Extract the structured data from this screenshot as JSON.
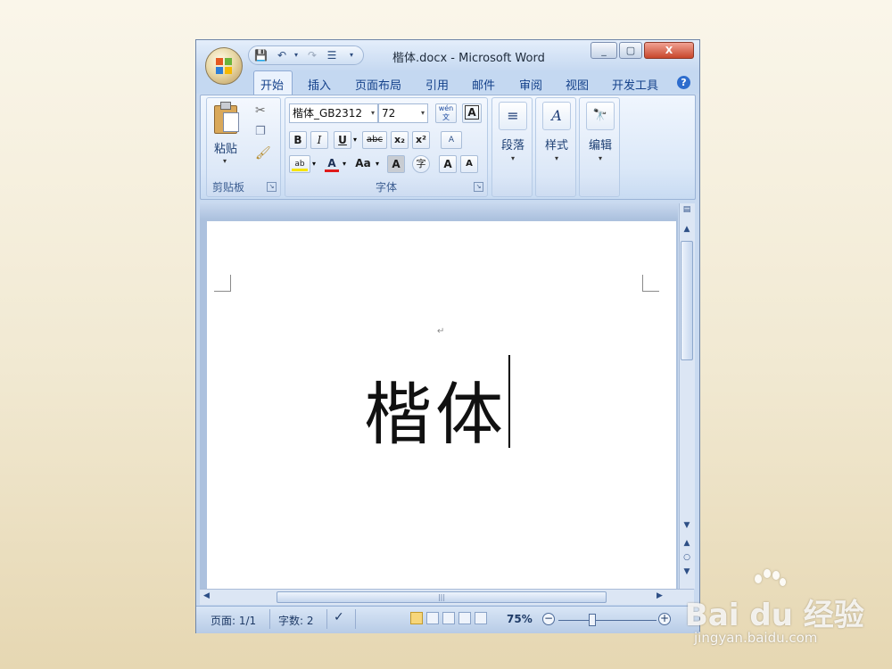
{
  "window": {
    "title": "楷体.docx - Microsoft Word",
    "minimize": "_",
    "maximize": "▢",
    "close": "X"
  },
  "tabs": [
    "开始",
    "插入",
    "页面布局",
    "引用",
    "邮件",
    "审阅",
    "视图",
    "开发工具"
  ],
  "help_label": "?",
  "ribbon": {
    "clipboard": {
      "label": "剪贴板",
      "paste_label": "粘贴"
    },
    "font": {
      "label": "字体",
      "font_name": "楷体_GB2312",
      "font_size": "72",
      "bold": "B",
      "italic": "I",
      "underline": "U",
      "strikethrough": "abc",
      "subscript": "x₂",
      "superscript": "x²",
      "change_case": "Aa",
      "grow_font": "A",
      "shrink_font": "A",
      "char_shading": "A",
      "phonetic": "wén 文",
      "clear_format": "A"
    },
    "paragraph": {
      "label": "段落"
    },
    "styles": {
      "label": "样式"
    },
    "editing": {
      "label": "编辑"
    }
  },
  "document": {
    "body_text": "楷体",
    "para_mark": "↵"
  },
  "statusbar": {
    "page": "页面: 1/1",
    "word_count": "字数: 2",
    "zoom": "75%",
    "zoom_level_percent": 75
  },
  "watermark": {
    "logo_text": "Bai du 经验",
    "url": "jingyan.baidu.com"
  },
  "colors": {
    "highlight": "#f5e400",
    "font_color": "#e01b1b",
    "ribbon_text": "#15428b"
  }
}
